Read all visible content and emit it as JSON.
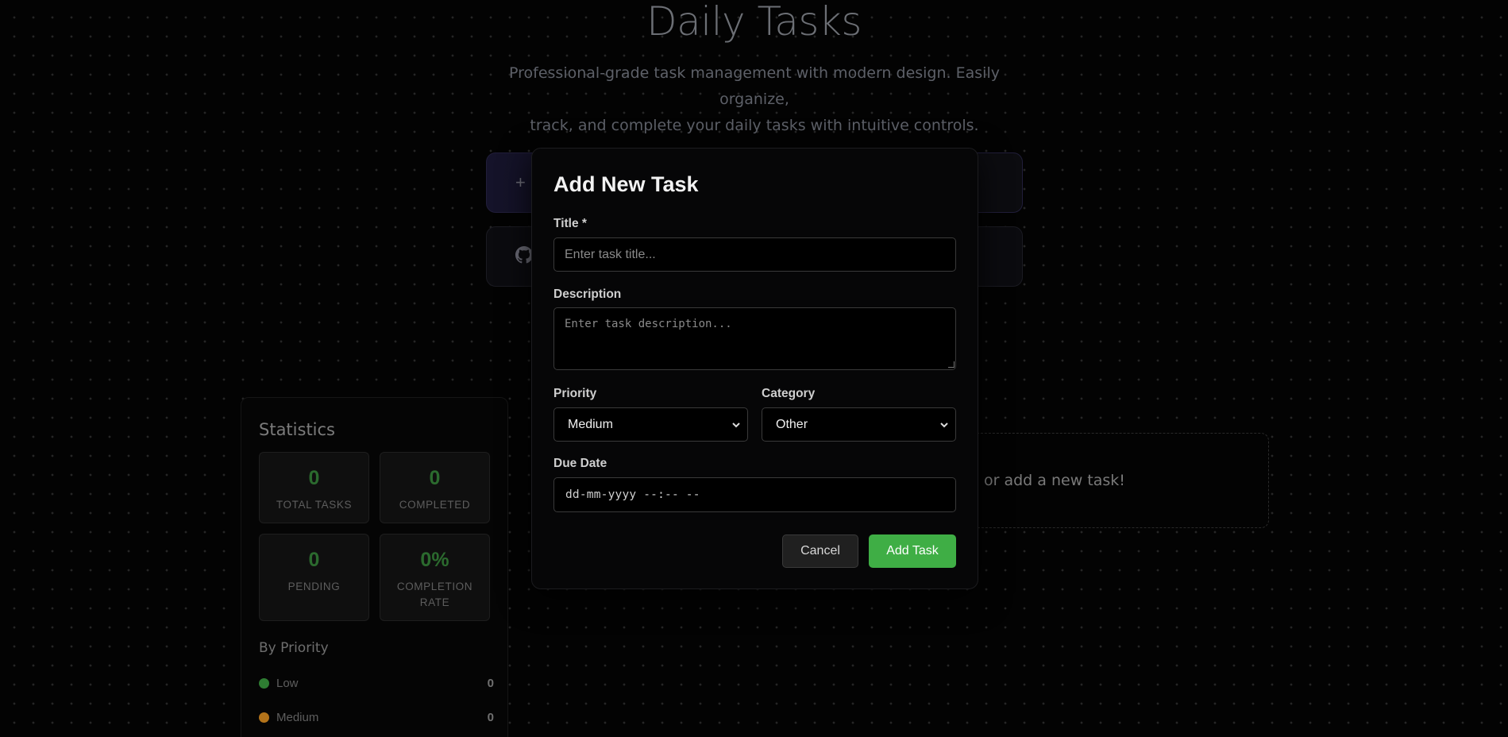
{
  "hero": {
    "title": "Daily Tasks",
    "description_line1": "Professional-grade task management with modern design. Easily organize,",
    "description_line2": "track, and complete your daily tasks with intuitive controls."
  },
  "background_buttons": {
    "add_icon": "+",
    "github_icon": "github-icon"
  },
  "statistics": {
    "title": "Statistics",
    "cards": [
      {
        "value": "0",
        "label": "Total Tasks"
      },
      {
        "value": "0",
        "label": "Completed"
      },
      {
        "value": "0",
        "label": "Pending"
      },
      {
        "value": "0%",
        "label": "Completion Rate"
      }
    ],
    "by_priority_title": "By Priority",
    "priorities": [
      {
        "name": "Low",
        "count": "0",
        "color": "#2e7d32"
      },
      {
        "name": "Medium",
        "count": "0",
        "color": "#b3731a"
      }
    ]
  },
  "empty_state": {
    "text": "or add a new task!"
  },
  "modal": {
    "title": "Add New Task",
    "title_label": "Title *",
    "title_placeholder": "Enter task title...",
    "description_label": "Description",
    "description_placeholder": "Enter task description...",
    "priority_label": "Priority",
    "priority_value": "Medium",
    "category_label": "Category",
    "category_value": "Other",
    "due_date_label": "Due Date",
    "due_date_placeholder": "dd-mm-yyyy --:-- --",
    "cancel_label": "Cancel",
    "add_label": "Add Task",
    "add_color": "#3fae45"
  }
}
